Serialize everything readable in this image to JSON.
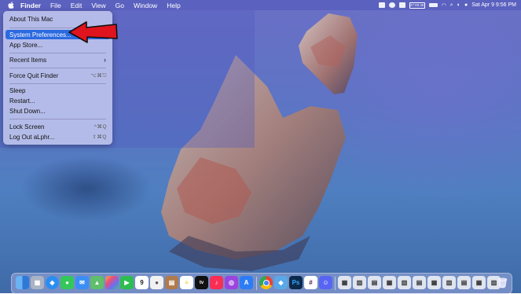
{
  "menubar": {
    "items": [
      "Finder",
      "File",
      "Edit",
      "View",
      "Go",
      "Window",
      "Help"
    ],
    "battery_label": "27:00:46",
    "datetime": "Sat Apr 9  9:56 PM"
  },
  "apple_menu": {
    "items": [
      {
        "label": "About This Mac",
        "shortcut": ""
      },
      {
        "label": "System Preferences...",
        "shortcut": ""
      },
      {
        "label": "App Store...",
        "shortcut": ""
      },
      {
        "label": "Recent Items",
        "shortcut": ""
      },
      {
        "label": "Force Quit Finder",
        "shortcut": "⌥⌘⎋"
      },
      {
        "label": "Sleep",
        "shortcut": ""
      },
      {
        "label": "Restart...",
        "shortcut": ""
      },
      {
        "label": "Shut Down...",
        "shortcut": ""
      },
      {
        "label": "Lock Screen",
        "shortcut": "^⌘Q"
      },
      {
        "label": "Log Out aLphr...",
        "shortcut": "⇧⌘Q"
      }
    ],
    "highlighted": "System Preferences..."
  },
  "dock": {
    "calendar_day": "9",
    "apple_tv_label": "tv",
    "photoshop_label": "Ps",
    "colors": {
      "accent": "#2c6ae0",
      "arrow": "#e0141e"
    }
  }
}
